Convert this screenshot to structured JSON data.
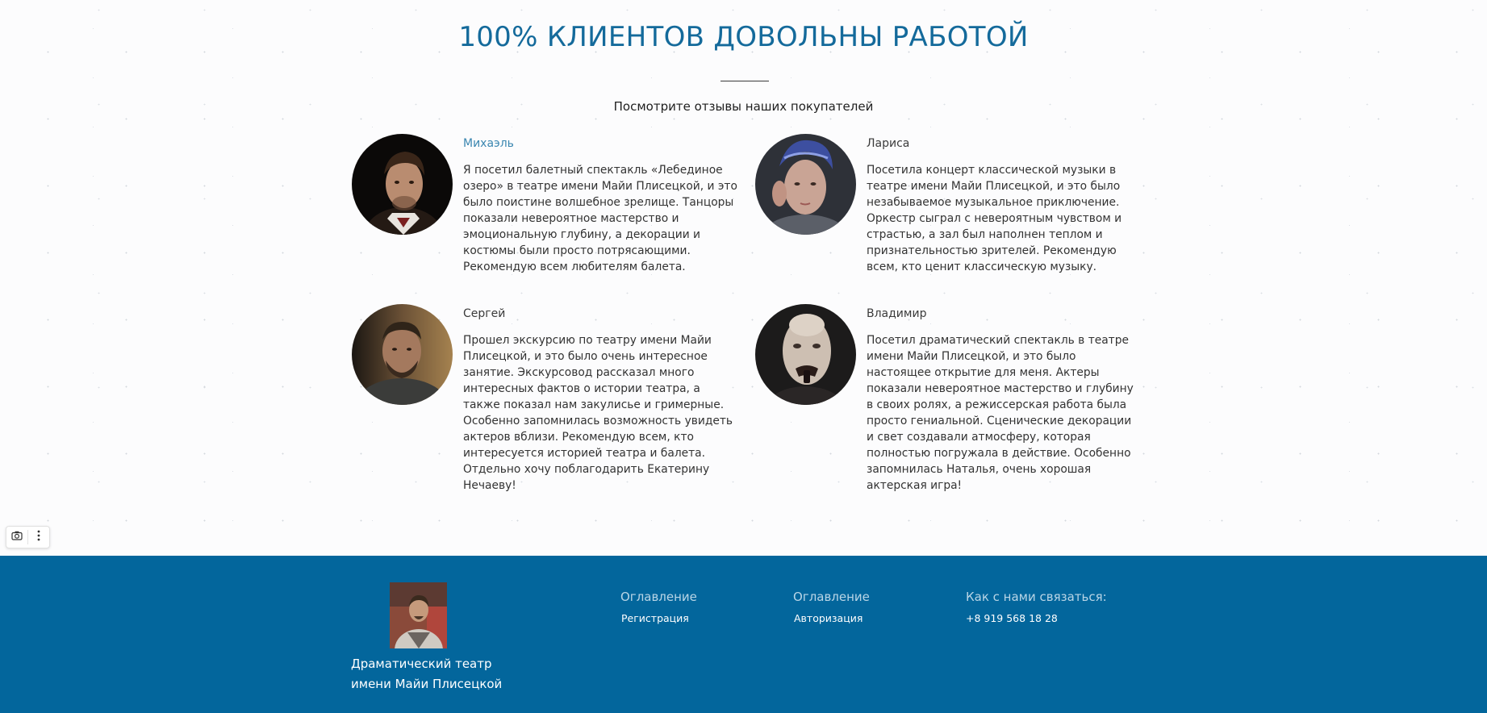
{
  "section": {
    "title": "100% КЛИЕНТОВ ДОВОЛЬНЫ РАБОТОЙ",
    "subtitle": "Посмотрите отзывы наших покупателей"
  },
  "reviews": [
    {
      "name": "Михаэль",
      "text": "Я посетил балетный спектакль «Лебединое озеро» в театре имени Майи Плисецкой, и это было поистине волшебное зрелище. Танцоры показали невероятное мастерство и эмоциональную глубину, а декорации и костюмы были просто потрясающими. Рекомендую всем любителям балета."
    },
    {
      "name": "Лариса",
      "text": "Посетила концерт классической музыки в театре имени Майи Плисецкой, и это было незабываемое музыкальное приключение. Оркестр сыграл с невероятным чувством и страстью, а зал был наполнен теплом и признательностью зрителей. Рекомендую всем, кто ценит классическую музыку."
    },
    {
      "name": "Сергей",
      "text": "Прошел экскурсию по театру имени Майи Плисецкой, и это было очень интересное занятие. Экскурсовод рассказал много интересных фактов о истории театра, а также показал нам закулисье и гримерные. Особенно запомнилась возможность увидеть актеров вблизи. Рекомендую всем, кто интересуется историей театра и балета. Отдельно хочу поблагодарить Екатерину Нечаеву!"
    },
    {
      "name": "Владимир",
      "text": "Посетил драматический спектакль в театре имени Майи Плисецкой, и это было настоящее открытие для меня. Актеры показали невероятное мастерство и глубину в своих ролях, а режиссерская работа была просто гениальной. Сценические декорации и свет создавали атмосферу, которая полностью погружала в действие. Особенно запомнилась Наталья, очень хорошая актерская игра!"
    }
  ],
  "footer": {
    "brand": "Драматический театр имени Майи Плисецкой",
    "col1_title": "Оглавление",
    "col1_link": "Регистрация",
    "col2_title": "Оглавление",
    "col2_link": "Авторизация",
    "contact_title": "Как с нами связаться:",
    "phone": "+8 919 568 18 28"
  },
  "colors": {
    "heading": "#146a9b",
    "footer_bg": "#03669c",
    "name_accent": "#3a86b0"
  },
  "icons": [
    "camera-icon",
    "more-vertical-icon"
  ]
}
